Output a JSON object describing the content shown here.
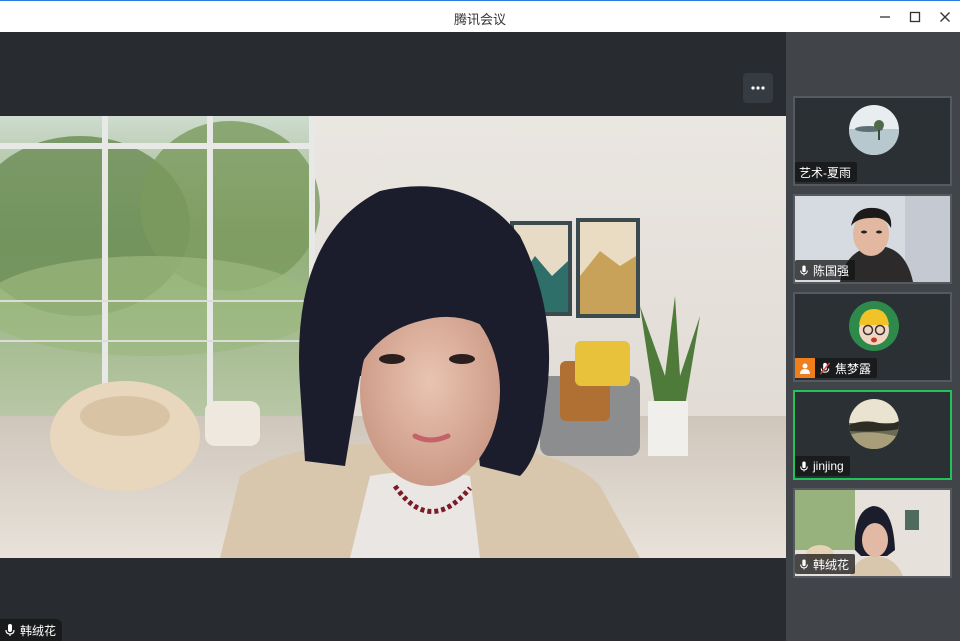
{
  "window": {
    "title": "腾讯会议",
    "accent": "#2b7be0"
  },
  "main": {
    "speaker_name": "韩绒花",
    "more_icon": "more-horizontal-icon",
    "mic_icon": "microphone-icon"
  },
  "participants": [
    {
      "name": "艺术-夏雨",
      "mic": "none",
      "kind": "avatar"
    },
    {
      "name": "陈国强",
      "mic": "on",
      "kind": "video"
    },
    {
      "name": "焦梦露",
      "mic": "muted",
      "kind": "avatar",
      "host": true
    },
    {
      "name": "jinjing",
      "mic": "on",
      "kind": "avatar",
      "speaking": true
    },
    {
      "name": "韩绒花",
      "mic": "on",
      "kind": "video"
    }
  ],
  "colors": {
    "speaking_border": "#20c45a",
    "host_badge": "#f07e1c",
    "muted": "#e0413a"
  }
}
